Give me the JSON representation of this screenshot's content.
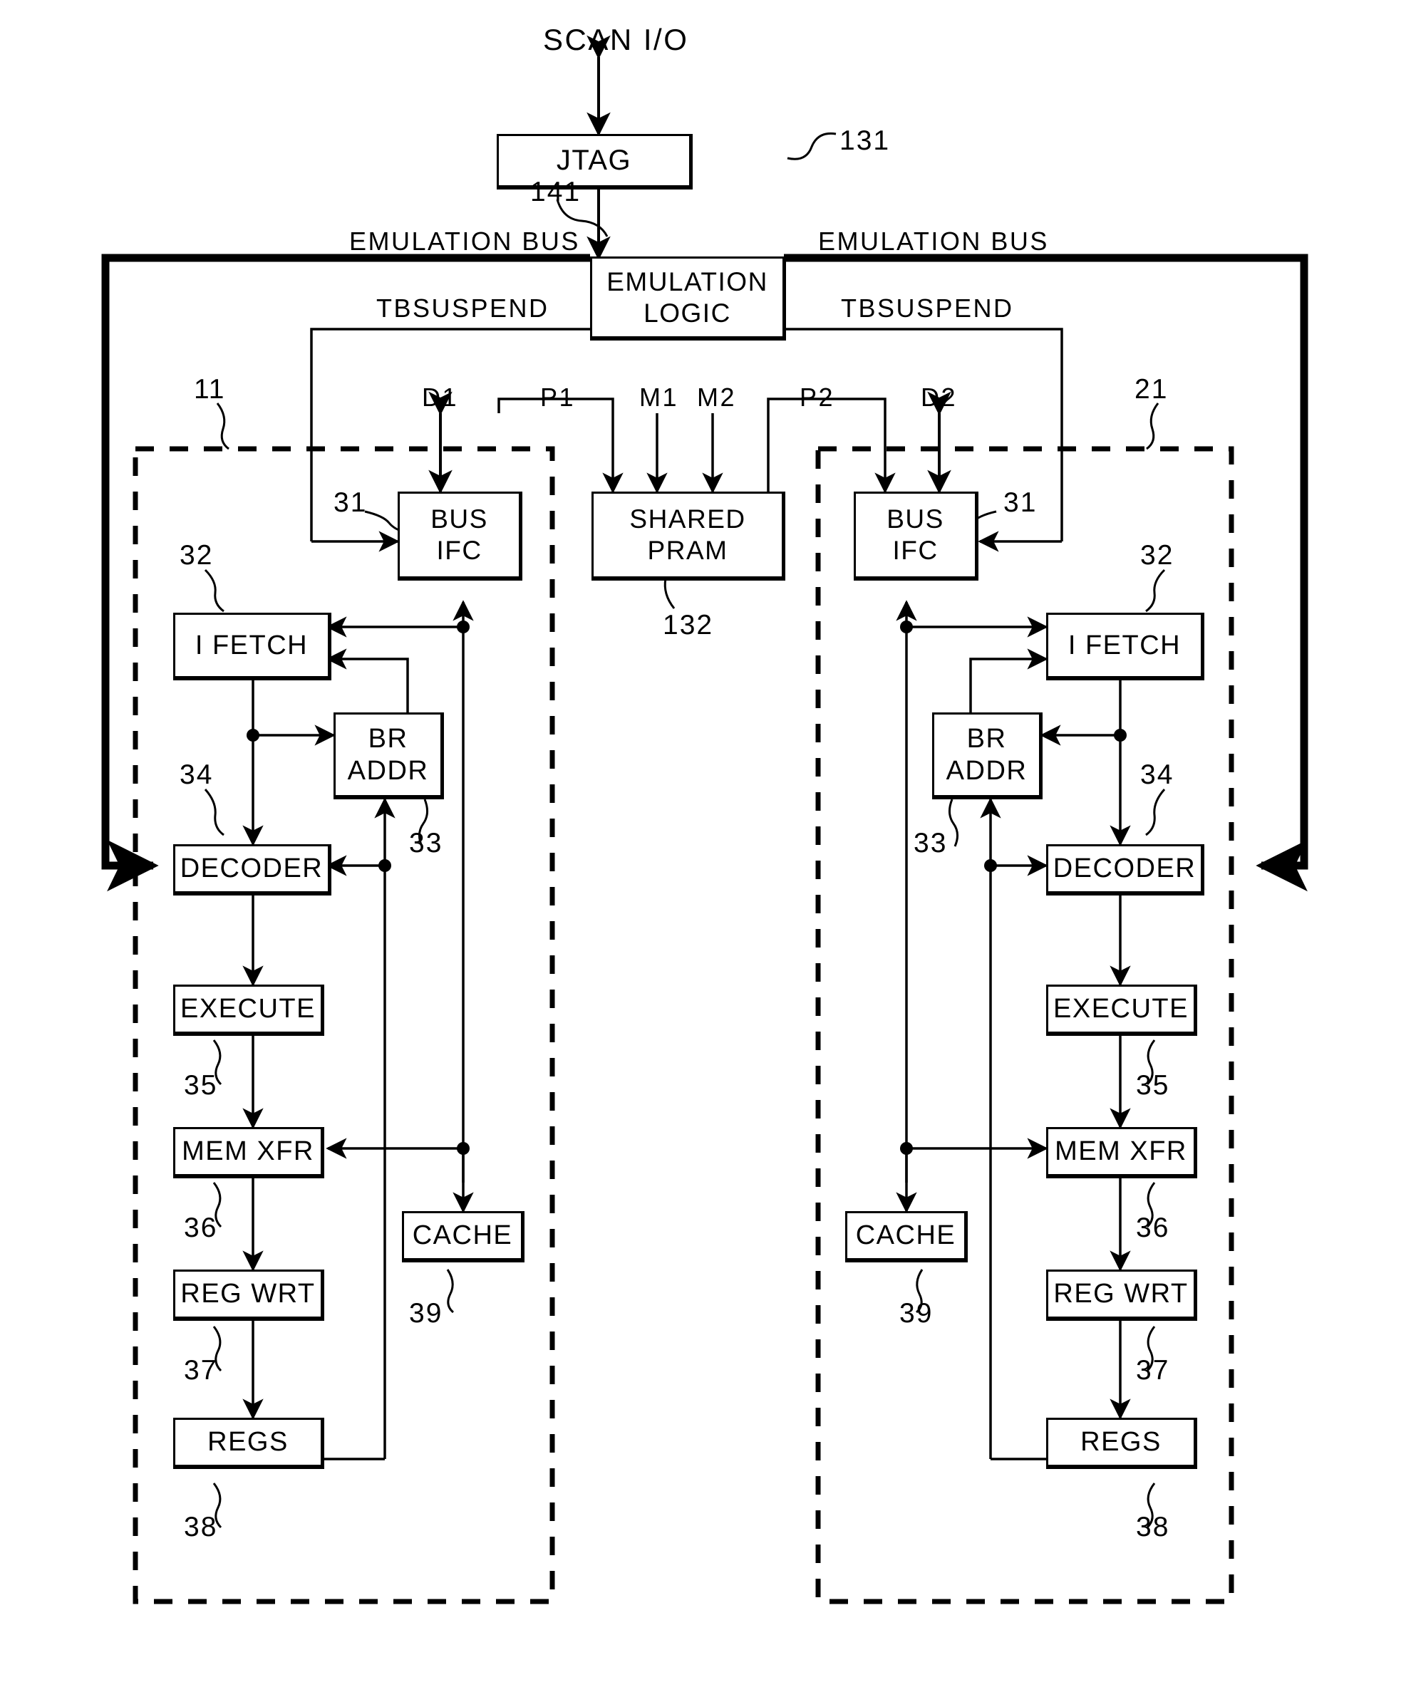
{
  "figure": {
    "title": "SCAN I/O",
    "scan_io_label": "SCAN I/O"
  },
  "blocks": {
    "jtag": {
      "lines": [
        "JTAG"
      ],
      "ref": "131"
    },
    "emulation": {
      "lines": [
        "EMULATION",
        "LOGIC"
      ],
      "ref": "141"
    },
    "shared_pram": {
      "lines": [
        "SHARED",
        "PRAM"
      ],
      "ref": "132"
    },
    "bus_ifc_l": {
      "lines": [
        "BUS",
        "IFC"
      ],
      "ref": "31"
    },
    "bus_ifc_r": {
      "lines": [
        "BUS",
        "IFC"
      ],
      "ref": "31"
    },
    "i_fetch_l": {
      "lines": [
        "I FETCH"
      ],
      "ref": "32"
    },
    "i_fetch_r": {
      "lines": [
        "I FETCH"
      ],
      "ref": "32"
    },
    "br_addr_l": {
      "lines": [
        "BR",
        "ADDR"
      ],
      "ref": "33"
    },
    "br_addr_r": {
      "lines": [
        "BR",
        "ADDR"
      ],
      "ref": "33"
    },
    "decoder_l": {
      "lines": [
        "DECODER"
      ],
      "ref": "34"
    },
    "decoder_r": {
      "lines": [
        "DECODER"
      ],
      "ref": "34"
    },
    "execute_l": {
      "lines": [
        "EXECUTE"
      ],
      "ref": "35"
    },
    "execute_r": {
      "lines": [
        "EXECUTE"
      ],
      "ref": "35"
    },
    "mem_xfr_l": {
      "lines": [
        "MEM XFR"
      ],
      "ref": "36"
    },
    "mem_xfr_r": {
      "lines": [
        "MEM XFR"
      ],
      "ref": "36"
    },
    "reg_wrt_l": {
      "lines": [
        "REG WRT"
      ],
      "ref": "37"
    },
    "reg_wrt_r": {
      "lines": [
        "REG WRT"
      ],
      "ref": "37"
    },
    "regs_l": {
      "lines": [
        "REGS"
      ],
      "ref": "38"
    },
    "regs_r": {
      "lines": [
        "REGS"
      ],
      "ref": "38"
    },
    "cache_l": {
      "lines": [
        "CACHE"
      ],
      "ref": "39"
    },
    "cache_r": {
      "lines": [
        "CACHE"
      ],
      "ref": "39"
    }
  },
  "signals": {
    "emulation_bus_left": "EMULATION BUS",
    "emulation_bus_right": "EMULATION BUS",
    "tbsuspend_left": "TBSUSPEND",
    "tbsuspend_right": "TBSUSPEND",
    "d1": "D1",
    "p1": "P1",
    "m1": "M1",
    "m2": "M2",
    "p2": "P2",
    "d2": "D2"
  },
  "boundaries": {
    "cpu_left_ref": "11",
    "cpu_right_ref": "21"
  },
  "colors": {
    "line": "#000000",
    "background": "#ffffff"
  }
}
